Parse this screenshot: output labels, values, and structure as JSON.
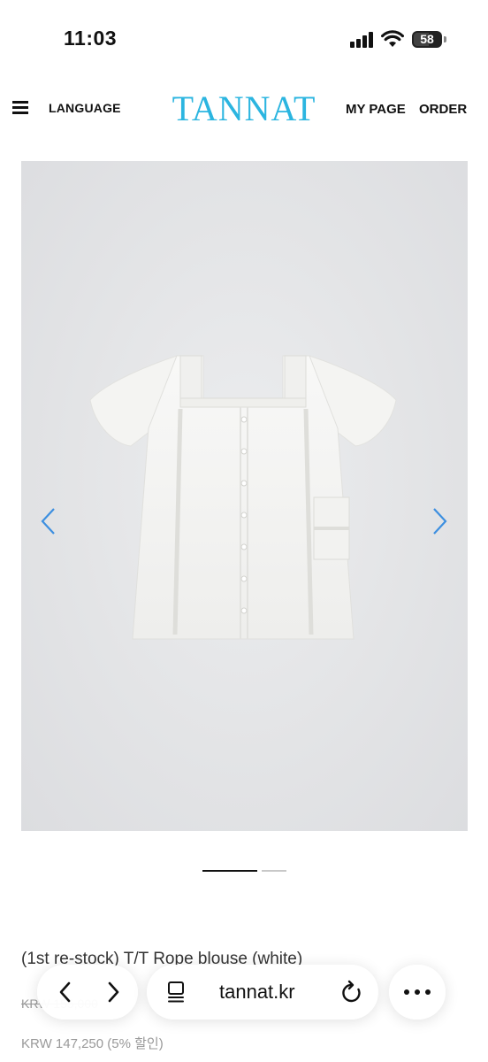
{
  "status_bar": {
    "time": "11:03",
    "battery_level": "58",
    "icons": [
      "cellular-signal-icon",
      "wifi-icon",
      "battery-icon"
    ]
  },
  "header": {
    "menu_icon": "hamburger-menu-icon",
    "language_label": "LANGUAGE",
    "logo_text": "TANNAT",
    "my_page_label": "MY PAGE",
    "order_label": "ORDER",
    "logo_color": "#2bb5e0"
  },
  "gallery": {
    "prev_icon": "chevron-left-icon",
    "next_icon": "chevron-right-icon",
    "arrow_color": "#3d8fe0",
    "background_color": "#e3e4e6",
    "current_slide": 1,
    "slide_count": 2
  },
  "product": {
    "name": "(1st re-stock) T/T Rope blouse (white)",
    "original_price": "KRW 155,000",
    "sale_price": "KRW 147,250 (5% 할인)"
  },
  "browser_toolbar": {
    "back_icon": "chevron-left-icon",
    "forward_icon": "chevron-right-icon",
    "reader_icon": "page-menu-icon",
    "url": "tannat.kr",
    "reload_icon": "reload-icon",
    "more_icon": "more-dots-icon"
  }
}
